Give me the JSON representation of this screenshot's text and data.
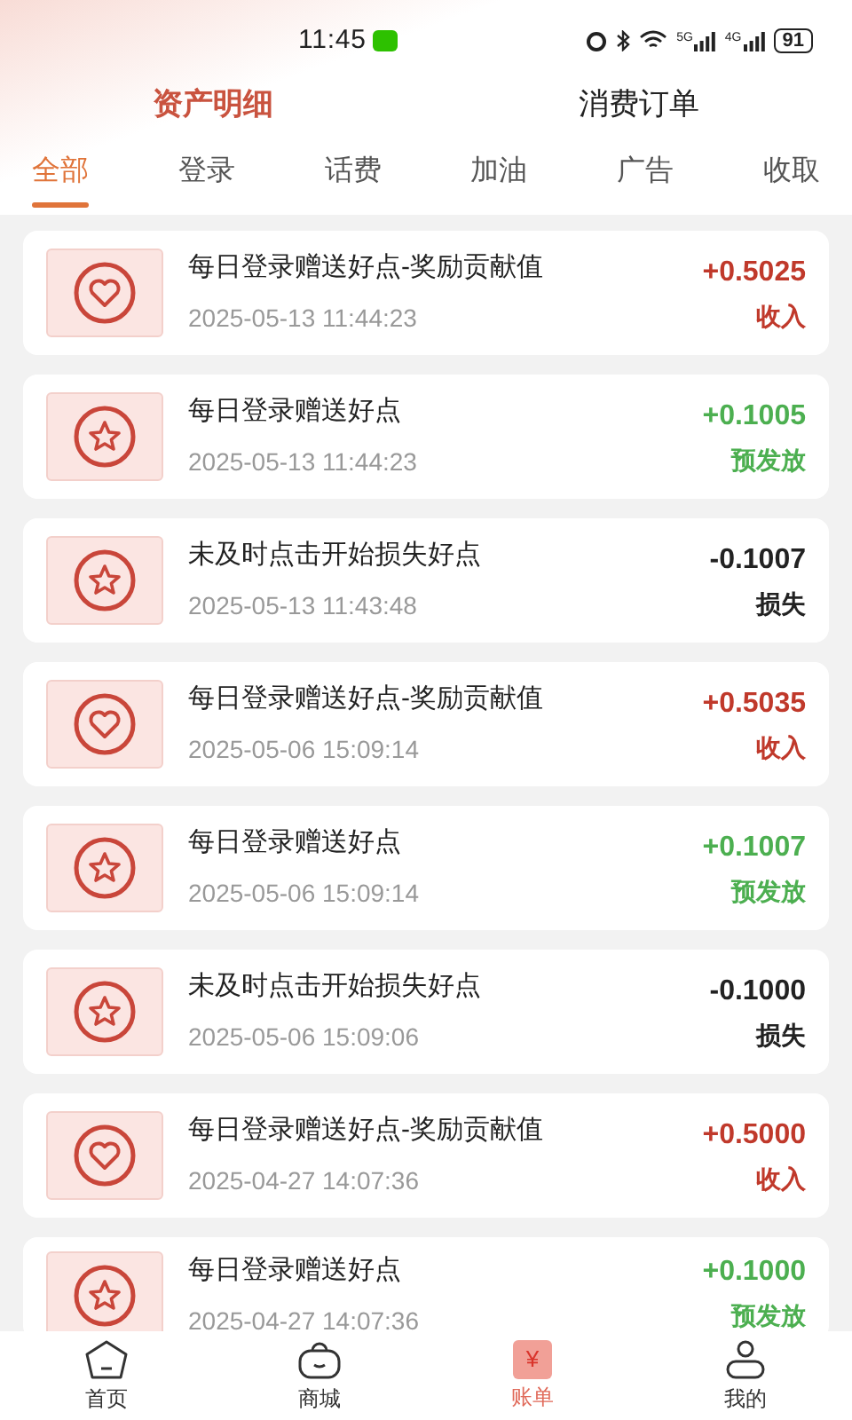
{
  "status_bar": {
    "time": "11:45",
    "networks": [
      "5G",
      "4G"
    ],
    "battery": "91"
  },
  "main_tabs": [
    {
      "label": "资产明细",
      "selected": true
    },
    {
      "label": "消费订单",
      "selected": false
    }
  ],
  "category_tabs": [
    {
      "label": "全部",
      "selected": true
    },
    {
      "label": "登录",
      "selected": false
    },
    {
      "label": "话费",
      "selected": false
    },
    {
      "label": "加油",
      "selected": false
    },
    {
      "label": "广告",
      "selected": false
    },
    {
      "label": "收取",
      "selected": false
    }
  ],
  "records": [
    {
      "title": "每日登录赠送好点-奖励贡献值",
      "time": "2025-05-13 11:44:23",
      "amount": "+0.5025",
      "status": "收入",
      "kind": "income"
    },
    {
      "title": "每日登录赠送好点",
      "time": "2025-05-13 11:44:23",
      "amount": "+0.1005",
      "status": "预发放",
      "kind": "pending"
    },
    {
      "title": "未及时点击开始损失好点",
      "time": "2025-05-13 11:43:48",
      "amount": "-0.1007",
      "status": "损失",
      "kind": "loss"
    },
    {
      "title": "每日登录赠送好点-奖励贡献值",
      "time": "2025-05-06 15:09:14",
      "amount": "+0.5035",
      "status": "收入",
      "kind": "income"
    },
    {
      "title": "每日登录赠送好点",
      "time": "2025-05-06 15:09:14",
      "amount": "+0.1007",
      "status": "预发放",
      "kind": "pending"
    },
    {
      "title": "未及时点击开始损失好点",
      "time": "2025-05-06 15:09:06",
      "amount": "-0.1000",
      "status": "损失",
      "kind": "loss"
    },
    {
      "title": "每日登录赠送好点-奖励贡献值",
      "time": "2025-04-27 14:07:36",
      "amount": "+0.5000",
      "status": "收入",
      "kind": "income"
    },
    {
      "title": "每日登录赠送好点",
      "time": "2025-04-27 14:07:36",
      "amount": "+0.1000",
      "status": "预发放",
      "kind": "pending"
    }
  ],
  "bottom_nav": [
    {
      "kind": "home",
      "label": "首页",
      "selected": false
    },
    {
      "kind": "shop",
      "label": "商城",
      "selected": false
    },
    {
      "kind": "bill",
      "label": "账单",
      "glyph": "¥",
      "selected": true
    },
    {
      "kind": "me",
      "label": "我的",
      "selected": false
    }
  ]
}
